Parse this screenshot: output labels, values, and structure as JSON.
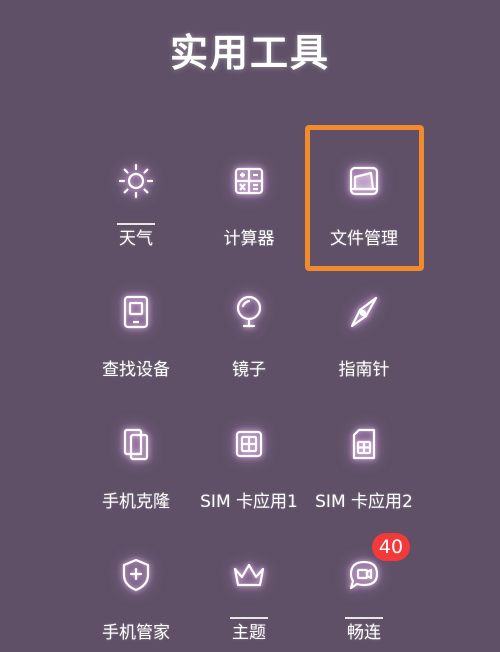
{
  "page_title": "实用工具",
  "tiles": [
    {
      "label": "天气",
      "icon": "sun-icon"
    },
    {
      "label": "计算器",
      "icon": "calculator-icon"
    },
    {
      "label": "文件管理",
      "icon": "folder-icon"
    },
    {
      "label": "查找设备",
      "icon": "phone-icon"
    },
    {
      "label": "镜子",
      "icon": "mirror-icon"
    },
    {
      "label": "指南针",
      "icon": "compass-icon"
    },
    {
      "label": "手机克隆",
      "icon": "phone-clone-icon"
    },
    {
      "label": "SIM 卡应用1",
      "icon": "sim-card-icon"
    },
    {
      "label": "SIM 卡应用2",
      "icon": "sim-card-icon"
    },
    {
      "label": "手机管家",
      "icon": "shield-icon"
    },
    {
      "label": "主题",
      "icon": "crown-icon"
    },
    {
      "label": "畅连",
      "icon": "chat-icon"
    }
  ],
  "badge": {
    "count": "40"
  },
  "colors": {
    "background": "#5f5067",
    "highlight_border": "#f28b2d",
    "badge": "#f23a3a"
  }
}
